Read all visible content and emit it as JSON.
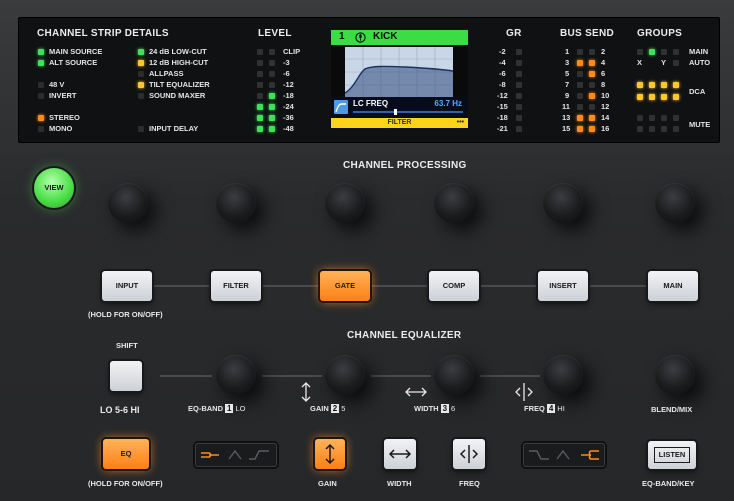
{
  "display": {
    "details": {
      "title": "CHANNEL STRIP DETAILS",
      "left": [
        {
          "label": "MAIN SOURCE",
          "state": "green"
        },
        {
          "label": "ALT SOURCE",
          "state": "green"
        },
        {
          "label": "48 V",
          "state": "off"
        },
        {
          "label": "INVERT",
          "state": "off"
        },
        {
          "label": "STEREO",
          "state": "orange"
        },
        {
          "label": "MONO",
          "state": "off"
        }
      ],
      "right": [
        {
          "label": "24 dB LOW-CUT",
          "state": "green"
        },
        {
          "label": "12 dB HIGH-CUT",
          "state": "yellow"
        },
        {
          "label": "ALLPASS",
          "state": "off"
        },
        {
          "label": "TILT EQUALIZER",
          "state": "yellow"
        },
        {
          "label": "SOUND MAXER",
          "state": "off"
        },
        {
          "label": "INPUT DELAY",
          "state": "off"
        }
      ]
    },
    "level": {
      "title": "LEVEL",
      "scale": [
        "CLIP",
        "-3",
        "-6",
        "-12",
        "-18",
        "-24",
        "-36",
        "-48"
      ]
    },
    "lcd": {
      "channel": "1",
      "name": "KICK",
      "param": "LC FREQ",
      "value": "63.7 Hz",
      "footer": "FILTER"
    },
    "gr": {
      "title": "GR",
      "scale": [
        "-2",
        "-4",
        "-6",
        "-8",
        "-12",
        "-15",
        "-18",
        "-21"
      ]
    },
    "bus_send": {
      "title": "BUS SEND",
      "left": [
        "1",
        "3",
        "5",
        "7",
        "9",
        "11",
        "13",
        "15"
      ],
      "right": [
        "2",
        "4",
        "6",
        "8",
        "10",
        "12",
        "14",
        "16"
      ]
    },
    "groups": {
      "title": "GROUPS",
      "labels": {
        "x": "X",
        "y": "Y",
        "main": "MAIN",
        "auto": "AUTO",
        "dca": "DCA",
        "mute": "MUTE"
      }
    }
  },
  "processing": {
    "title": "CHANNEL PROCESSING",
    "view": "VIEW",
    "buttons": [
      "INPUT",
      "FILTER",
      "GATE",
      "COMP",
      "INSERT",
      "MAIN"
    ],
    "hold_note": "(HOLD FOR ON/OFF)"
  },
  "equalizer": {
    "title": "CHANNEL EQUALIZER",
    "shift": "SHIFT",
    "range": "LO 5-6 HI",
    "eq_band": {
      "label": "EQ-BAND",
      "num": "1",
      "tag": "LO"
    },
    "gain": {
      "label": "GAIN",
      "num": "2",
      "tag": "5"
    },
    "width": {
      "label": "WIDTH",
      "num": "3",
      "tag": "6"
    },
    "freq": {
      "label": "FREQ",
      "num": "4",
      "tag": "HI"
    },
    "blend": "BLEND/MIX"
  },
  "bottom": {
    "eq": "EQ",
    "hold_note": "(HOLD FOR ON/OFF)",
    "gain": "GAIN",
    "width": "WIDTH",
    "freq": "FREQ",
    "listen": "LISTEN",
    "eq_band_key": "EQ-BAND/KEY"
  },
  "colors": {
    "green": "#3fe05a",
    "orange": "#ff8a1c",
    "yellow": "#ffc72a"
  }
}
